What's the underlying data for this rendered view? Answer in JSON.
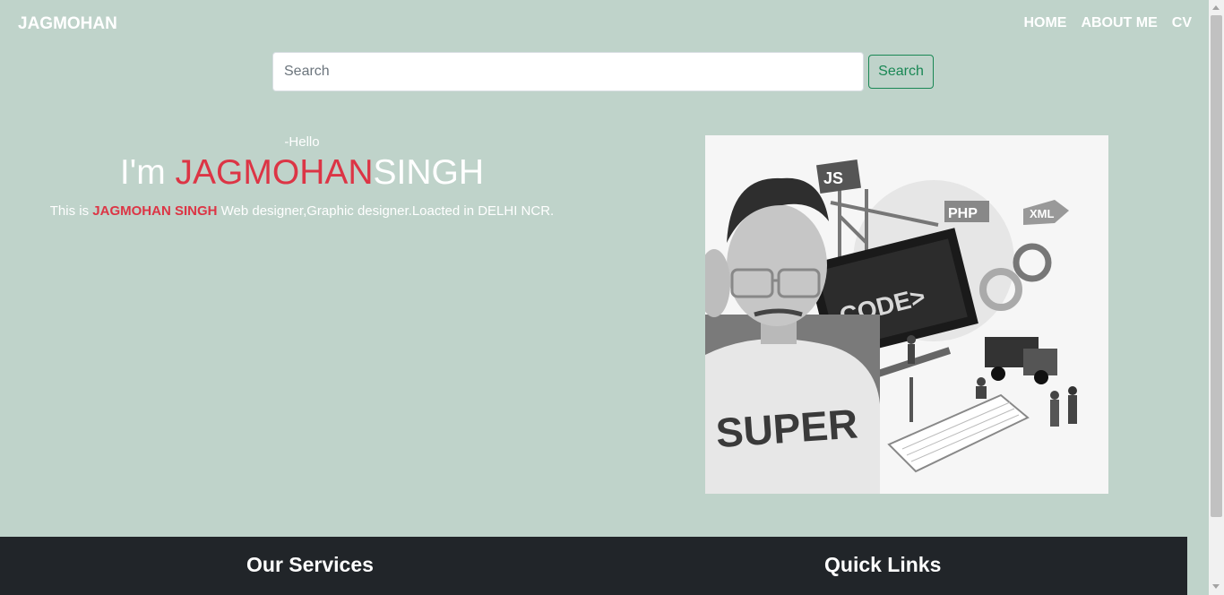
{
  "navbar": {
    "brand": "JAGMOHAN",
    "links": [
      "HOME",
      "ABOUT ME",
      "CV"
    ]
  },
  "search": {
    "placeholder": "Search",
    "value": "",
    "button_label": "Search"
  },
  "hero": {
    "greeting": "-Hello",
    "headline_prefix": "I'm ",
    "headline_first": "JAGMOHAN",
    "headline_last": "SINGH",
    "intro_prefix": "This is ",
    "intro_name": "JAGMOHAN SINGH",
    "intro_suffix": " Web designer,Graphic designer.Loacted in DELHI NCR."
  },
  "illustration": {
    "badges": [
      "JS",
      "PHP",
      "XML"
    ],
    "screen_text": "CODE>",
    "shirt_text": "SUPER"
  },
  "footer": {
    "services_heading": "Our Services",
    "links_heading": "Quick Links"
  },
  "colors": {
    "page_bg": "#bfd3ca",
    "accent_red": "#dc3545",
    "success_green": "#198754",
    "footer_bg": "#212529"
  }
}
